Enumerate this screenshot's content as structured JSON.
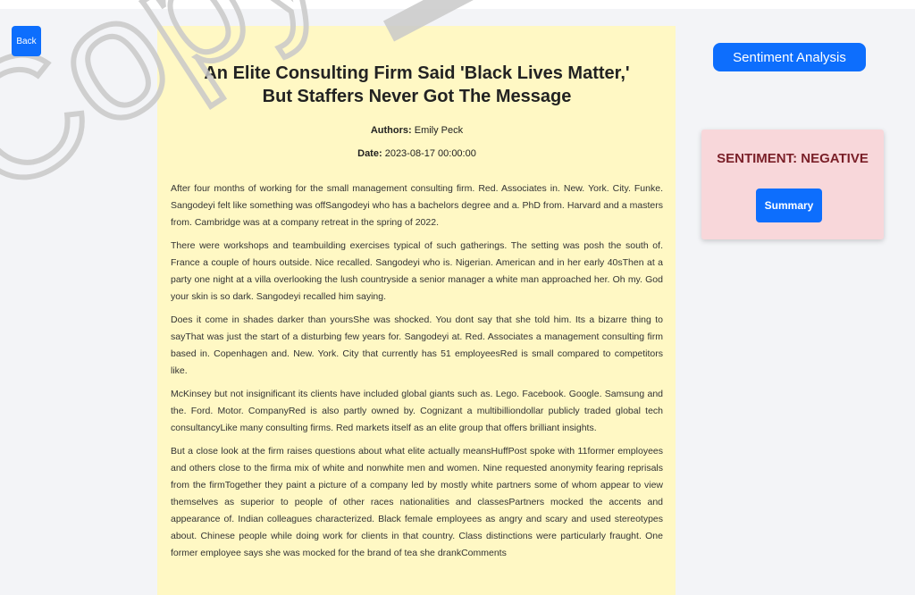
{
  "nav": {
    "back_label": "Back"
  },
  "article": {
    "title": "An Elite Consulting Firm Said 'Black Lives Matter,' But Staffers Never Got The Message",
    "authors_label": "Authors:",
    "authors": "Emily Peck",
    "date_label": "Date:",
    "date": "2023-08-17 00:00:00",
    "paragraphs": [
      "After four months of working for the small management consulting firm. Red. Associates in. New. York. City. Funke. Sangodeyi felt like something was offSangodeyi who has a bachelors degree and a. PhD from. Harvard and a masters from. Cambridge was at a company retreat in the spring of 2022.",
      "There were workshops and teambuilding exercises typical of such gatherings. The setting was posh the south of. France a couple of hours outside. Nice recalled. Sangodeyi who is. Nigerian. American and in her early 40sThen at a party one night at a villa overlooking the lush countryside a senior manager a white man approached her. Oh my. God your skin is so dark. Sangodeyi recalled him saying.",
      "Does it come in shades darker than yoursShe was shocked. You dont say that she told him. Its a bizarre thing to sayThat was just the start of a disturbing few years for. Sangodeyi at. Red. Associates a management consulting firm based in. Copenhagen and. New. York. City that currently has 51 employeesRed is small compared to competitors like.",
      "McKinsey but not insignificant its clients have included global giants such as. Lego. Facebook. Google. Samsung and the. Ford. Motor. CompanyRed is also partly owned by. Cognizant a multibilliondollar publicly traded global tech consultancyLike many consulting firms. Red markets itself as an elite group that offers brilliant insights.",
      "But a close look at the firm raises questions about what elite actually meansHuffPost spoke with 11former employees and others close to the firma mix of white and nonwhite men and women. Nine requested anonymity fearing reprisals from the firmTogether they paint a picture of a company led by mostly white partners some of whom appear to view themselves as superior to people of other races nationalities and classesPartners mocked the accents and appearance of. Indian colleagues characterized. Black female employees as angry and scary and used stereotypes about. Chinese people while doing work for clients in that country. Class distinctions were particularly fraught. One former employee says she was mocked for the brand of tea she drankComments"
    ]
  },
  "sidebar": {
    "sentiment_button_label": "Sentiment Analysis",
    "result_label": "SENTIMENT: NEGATIVE",
    "summary_button_label": "Summary"
  },
  "watermark": {
    "text": "Copy"
  },
  "colors": {
    "primary": "#0d6efd",
    "article_bg": "#fff8c4",
    "result_bg": "#f8d7da",
    "result_text": "#7a1f28"
  }
}
